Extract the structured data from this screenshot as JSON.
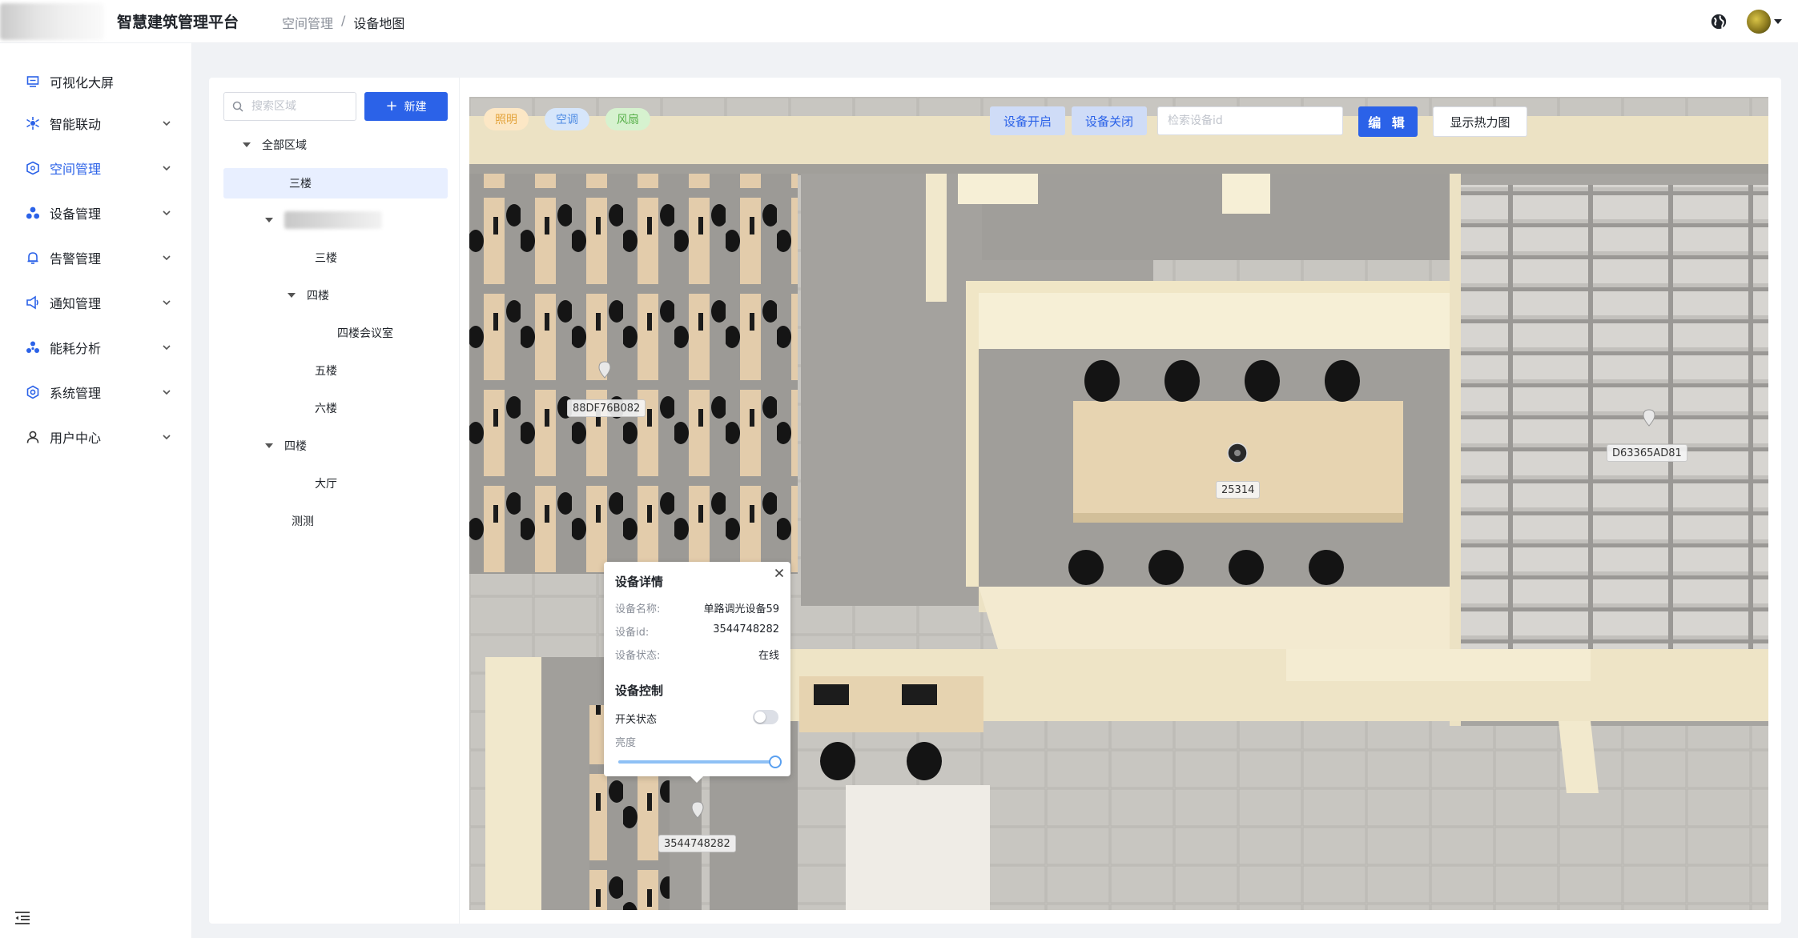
{
  "header": {
    "app_title": "智慧建筑管理平台",
    "breadcrumb": [
      "空间管理",
      "设备地图"
    ],
    "breadcrumb_sep": "/"
  },
  "sidebar": {
    "items": [
      {
        "label": "可视化大屏",
        "icon": "monitor-icon"
      },
      {
        "label": "智能联动",
        "icon": "linkage-icon"
      },
      {
        "label": "空间管理",
        "icon": "cube-icon",
        "active": true
      },
      {
        "label": "设备管理",
        "icon": "devices-icon"
      },
      {
        "label": "告警管理",
        "icon": "bell-icon"
      },
      {
        "label": "通知管理",
        "icon": "megaphone-icon"
      },
      {
        "label": "能耗分析",
        "icon": "energy-icon"
      },
      {
        "label": "系统管理",
        "icon": "gear-icon"
      },
      {
        "label": "用户中心",
        "icon": "user-icon"
      }
    ]
  },
  "tree": {
    "search_placeholder": "搜索区域",
    "new_label": "新建",
    "nodes": [
      {
        "label": "全部区域",
        "level": 0,
        "expanded": true
      },
      {
        "label": "三楼",
        "level": 1,
        "selected": true
      },
      {
        "label": "",
        "level": 1,
        "expanded": true,
        "blurred": true
      },
      {
        "label": "三楼",
        "level": 2
      },
      {
        "label": "四楼",
        "level": 2,
        "expanded": true
      },
      {
        "label": "四楼会议室",
        "level": 3
      },
      {
        "label": "五楼",
        "level": 2
      },
      {
        "label": "六楼",
        "level": 2
      },
      {
        "label": "四楼",
        "level": 1,
        "expanded": true
      },
      {
        "label": "大厅",
        "level": 2
      },
      {
        "label": "测测",
        "level": 1
      }
    ]
  },
  "map": {
    "tags": [
      "照明",
      "空调",
      "风扇"
    ],
    "turn_on_label": "设备开启",
    "turn_off_label": "设备关闭",
    "device_search_placeholder": "检索设备id",
    "edit_label": "编 辑",
    "heatmap_label": "显示热力图",
    "device_labels": [
      "88DF76B082",
      "25314",
      "D63365AD81",
      "3544748282"
    ]
  },
  "popup": {
    "title": "设备详情",
    "rows": [
      {
        "key": "设备名称:",
        "value": "单路调光设备59"
      },
      {
        "key": "设备id:",
        "value": "3544748282"
      },
      {
        "key": "设备状态:",
        "value": "在线"
      }
    ],
    "control_title": "设备控制",
    "switch_label": "开关状态",
    "switch_on": false,
    "brightness_label": "亮度",
    "brightness": 1.0
  }
}
